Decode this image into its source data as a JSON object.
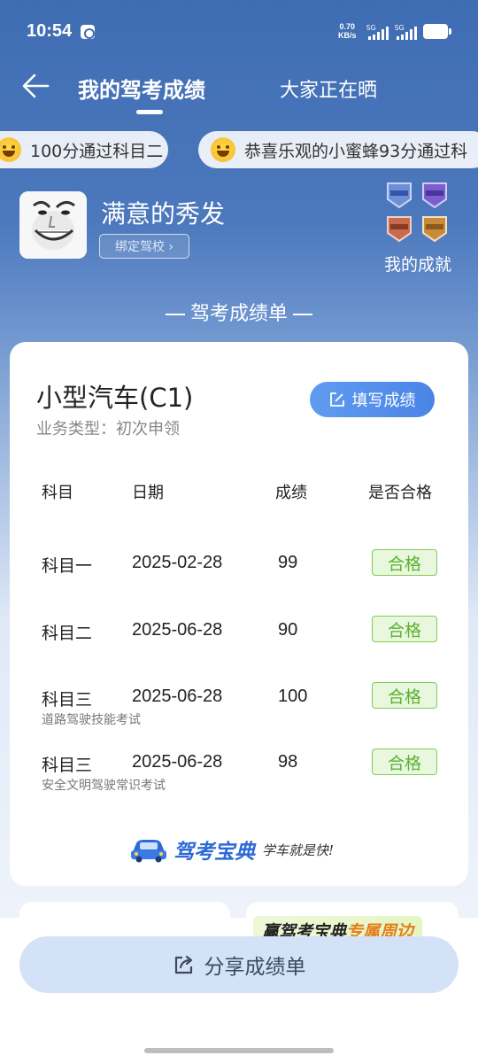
{
  "status_bar": {
    "time": "10:54",
    "net_speed_value": "0.70",
    "net_speed_unit": "KB/s",
    "signal_1_label": "5G",
    "signal_2_label": "5G"
  },
  "header": {
    "tab_mine": "我的驾考成绩",
    "tab_others": "大家正在晒"
  },
  "ticker": {
    "item_1": "100分通过科目二",
    "item_2": "恭喜乐观的小蜜蜂93分通过科"
  },
  "profile": {
    "username": "满意的秀发",
    "bind_school": "绑定驾校 ›",
    "achievements_label": "我的成就"
  },
  "section_title": "驾考成绩单",
  "card": {
    "vehicle_type": "小型汽车(C1)",
    "business_type": "业务类型：初次申领",
    "fill_button": "填写成绩",
    "headers": {
      "subject": "科目",
      "date": "日期",
      "score": "成绩",
      "pass": "是否合格"
    },
    "rows": [
      {
        "subject": "科目一",
        "date": "2025-02-28",
        "score": "99",
        "result": "合格",
        "note": ""
      },
      {
        "subject": "科目二",
        "date": "2025-06-28",
        "score": "90",
        "result": "合格",
        "note": ""
      },
      {
        "subject": "科目三",
        "date": "2025-06-28",
        "score": "100",
        "result": "合格",
        "note": "道路驾驶技能考试"
      },
      {
        "subject": "科目三",
        "date": "2025-06-28",
        "score": "98",
        "result": "合格",
        "note": "安全文明驾驶常识考试"
      }
    ],
    "brand_name": "驾考宝典",
    "brand_slogan": "学车就是快!"
  },
  "promo": {
    "prefix": "赢驾考宝典",
    "highlight": "专属周边"
  },
  "share_button": "分享成绩单",
  "colors": {
    "header_blue": "#3f6db3",
    "accent_blue": "#4a84e6",
    "pass_green": "#5cb231",
    "share_bg": "#d4e2f7"
  }
}
